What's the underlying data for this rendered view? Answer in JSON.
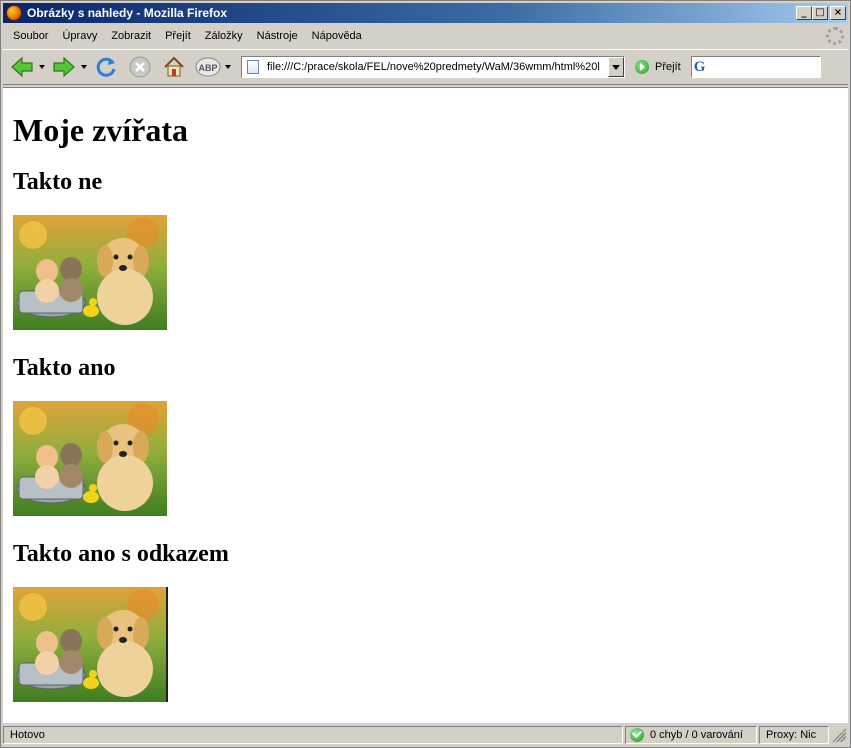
{
  "window": {
    "title": "Obrázky s nahledy - Mozilla Firefox",
    "controls": {
      "minimize": "_",
      "maximize": "□",
      "close": "×"
    }
  },
  "menu": {
    "items": [
      {
        "label": "Soubor"
      },
      {
        "label": "Úpravy"
      },
      {
        "label": "Zobrazit"
      },
      {
        "label": "Přejít"
      },
      {
        "label": "Záložky"
      },
      {
        "label": "Nástroje"
      },
      {
        "label": "Nápověda"
      }
    ]
  },
  "toolbar": {
    "icons": [
      "back-icon",
      "forward-icon",
      "reload-icon",
      "stop-icon",
      "home-icon",
      "adblock-icon"
    ],
    "adblock_label": "ABP",
    "url": "file:///C:/prace/skola/FEL/nove%20predmety/WaM/36wmm/html%20l",
    "go_label": "Přejít",
    "search_engine_letter": "G"
  },
  "content": {
    "heading": "Moje zvířata",
    "sections": [
      {
        "title": "Takto ne"
      },
      {
        "title": "Takto ano"
      },
      {
        "title": "Takto ano s odkazem"
      }
    ]
  },
  "status": {
    "text": "Hotovo",
    "errors": "0 chyb / 0 varování",
    "proxy": "Proxy: Nic"
  },
  "colors": {
    "titlebar_start": "#0a246a",
    "titlebar_end": "#a6caf0",
    "chrome": "#d4d0c8"
  }
}
